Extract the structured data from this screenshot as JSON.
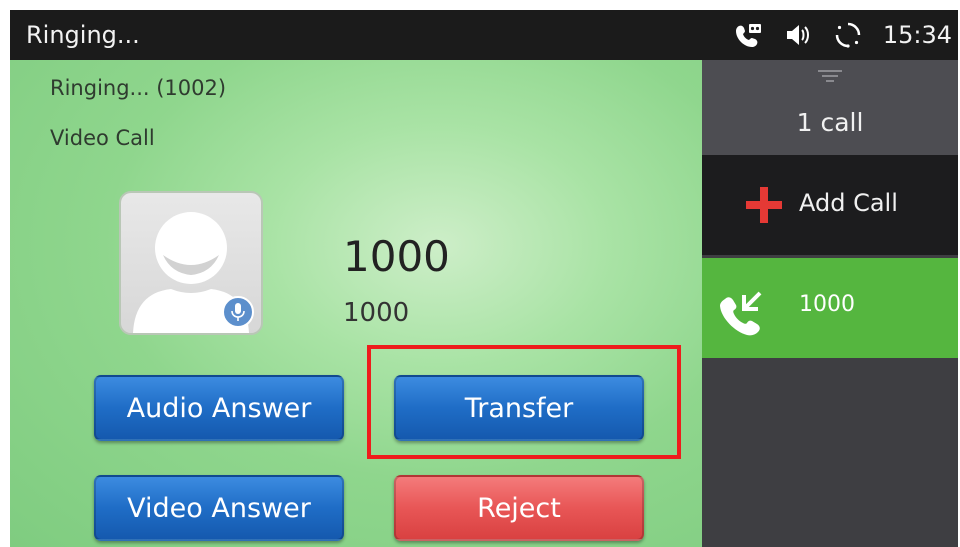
{
  "statusbar": {
    "title": "Ringing...",
    "time": "15:34",
    "icons": [
      "phone-voicemail-icon",
      "speaker-volume-icon",
      "sync-loading-icon"
    ]
  },
  "call": {
    "state": "Ringing... (1002)",
    "type": "Video Call",
    "caller_name": "1000",
    "caller_number": "1000",
    "avatar_icon": "default-avatar-icon",
    "badge_icon": "microphone-icon"
  },
  "buttons": {
    "audio_answer": "Audio Answer",
    "transfer": "Transfer",
    "video_answer": "Video Answer",
    "reject": "Reject"
  },
  "side_panel": {
    "call_count": "1 call",
    "add_call_label": "Add Call",
    "active_call_label": "1000"
  },
  "colors": {
    "accent_green": "#55b63f",
    "button_blue": "#1f6dc6",
    "button_red": "#e85656",
    "highlight_red": "#ee1c1c"
  }
}
